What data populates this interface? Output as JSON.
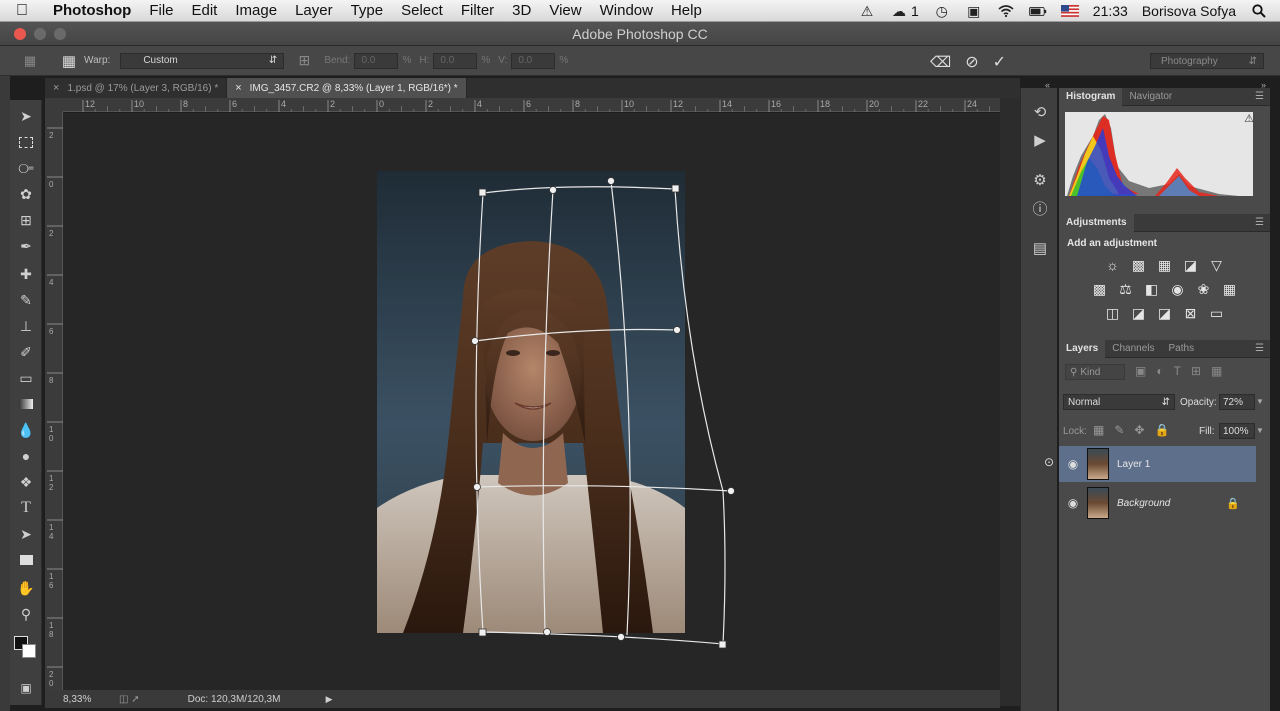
{
  "menubar": {
    "app_name": "Photoshop",
    "items": [
      "File",
      "Edit",
      "Image",
      "Layer",
      "Type",
      "Select",
      "Filter",
      "3D",
      "View",
      "Window",
      "Help"
    ],
    "cc_count": "1",
    "time": "21:33",
    "user": "Borisova Sofya"
  },
  "window": {
    "title": "Adobe Photoshop CC"
  },
  "options": {
    "warp_label": "Warp:",
    "warp_value": "Custom",
    "bend_label": "Bend:",
    "bend_value": "0.0",
    "h_label": "H:",
    "h_value": "0.0",
    "v_label": "V:",
    "v_value": "0.0",
    "percent": "%",
    "workspace": "Photography"
  },
  "tabs": [
    {
      "label": "1.psd @ 17% (Layer 3, RGB/16) *",
      "active": false
    },
    {
      "label": "IMG_3457.CR2 @ 8,33% (Layer 1, RGB/16*) *",
      "active": true
    }
  ],
  "ruler": {
    "h_ticks": [
      "12",
      "10",
      "8",
      "6",
      "4",
      "2",
      "0",
      "2",
      "4",
      "6",
      "8",
      "10",
      "12",
      "14",
      "16",
      "18",
      "20",
      "22",
      "24"
    ],
    "v_ticks": [
      "2",
      "0",
      "2",
      "4",
      "6",
      "8",
      "1\n0",
      "1\n2",
      "1\n4",
      "1\n6",
      "1\n8",
      "2\n0"
    ]
  },
  "status": {
    "zoom": "8,33%",
    "doc": "Doc: 120,3M/120,3M"
  },
  "panels": {
    "histogram_tab": "Histogram",
    "navigator_tab": "Navigator",
    "adjustments_tab": "Adjustments",
    "add_adjustment": "Add an adjustment",
    "layers_tab": "Layers",
    "channels_tab": "Channels",
    "paths_tab": "Paths",
    "kind_label": "Kind",
    "blend_mode": "Normal",
    "opacity_label": "Opacity:",
    "opacity_value": "72%",
    "lock_label": "Lock:",
    "fill_label": "Fill:",
    "fill_value": "100%",
    "layers": [
      {
        "name": "Layer 1",
        "selected": true
      },
      {
        "name": "Background",
        "selected": false,
        "locked": true
      }
    ]
  }
}
